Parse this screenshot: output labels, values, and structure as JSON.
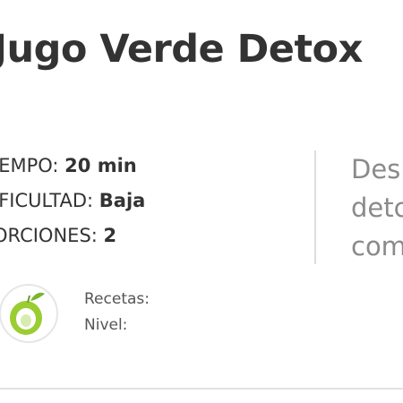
{
  "recipe": {
    "title": "Jugo Verde Detox",
    "meta": [
      {
        "key": "IEMPO: ",
        "value": "20 min"
      },
      {
        "key": "IFICULTAD: ",
        "value": "Baja"
      },
      {
        "key": "ORCIONES: ",
        "value": "2"
      }
    ],
    "description_lines": [
      "Desl",
      "detc",
      "com"
    ]
  },
  "author": {
    "logo_icon": "green-fruit-logo-icon",
    "stats": [
      "Recetas:",
      "Nivel:"
    ]
  },
  "colors": {
    "text": "#333333",
    "muted": "#8a8a8a",
    "accent_green": "#8cc63f",
    "divider": "#dddddd"
  }
}
